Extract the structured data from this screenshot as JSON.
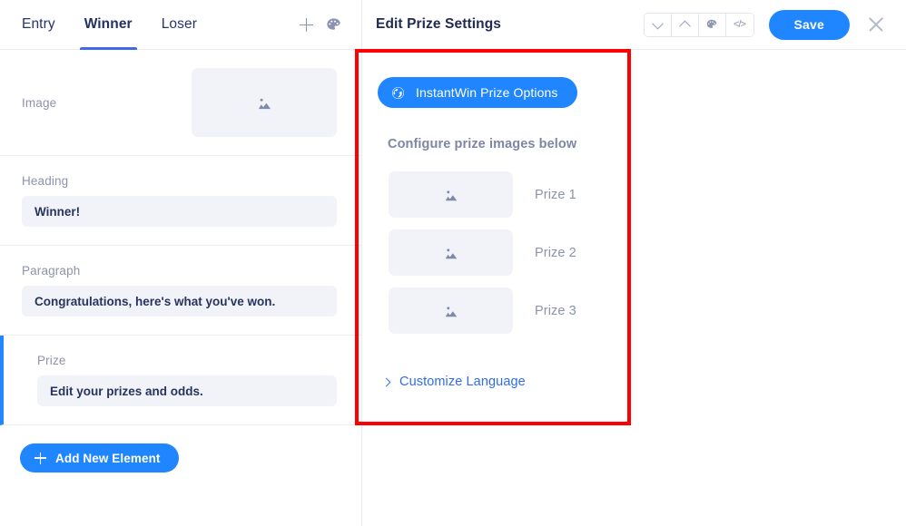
{
  "left_panel": {
    "tabs": [
      {
        "label": "Entry",
        "active": false
      },
      {
        "label": "Winner",
        "active": true
      },
      {
        "label": "Loser",
        "active": false
      }
    ],
    "toolbar": {
      "add_icon": "plus-icon",
      "theme_icon": "palette-icon"
    },
    "fields": [
      {
        "label": "Image",
        "type": "image",
        "placeholder_icon": "image-placeholder-icon",
        "selected": false
      },
      {
        "label": "Heading",
        "type": "text",
        "value": "Winner!",
        "selected": false
      },
      {
        "label": "Paragraph",
        "type": "text",
        "value": "Congratulations, here's what you've won.",
        "selected": false
      },
      {
        "label": "Prize",
        "type": "text",
        "value": "Edit your prizes and odds.",
        "selected": true
      }
    ],
    "add_element_button": "Add New Element"
  },
  "right_panel": {
    "title": "Edit Prize Settings",
    "toolbar_buttons": [
      {
        "name": "move-down-button",
        "icon": "chevron-down-icon"
      },
      {
        "name": "move-up-button",
        "icon": "chevron-up-icon"
      },
      {
        "name": "theme-button",
        "icon": "palette-icon"
      },
      {
        "name": "code-button",
        "icon": "code-icon",
        "glyph": "</>"
      }
    ],
    "save_label": "Save",
    "close_icon": "close-icon",
    "instantwin_button": {
      "label": "InstantWin Prize Options",
      "icon": "globe-icon"
    },
    "section_label": "Configure prize images below",
    "prizes": [
      {
        "name": "Prize 1",
        "thumb_icon": "image-placeholder-icon"
      },
      {
        "name": "Prize 2",
        "thumb_icon": "image-placeholder-icon"
      },
      {
        "name": "Prize 3",
        "thumb_icon": "image-placeholder-icon"
      }
    ],
    "customize_language": {
      "label": "Customize Language",
      "icon": "chevron-right-icon"
    }
  },
  "annotation": {
    "color": "#ff0000",
    "shape": "rectangle"
  },
  "colors": {
    "primary_blue": "#1f86ff",
    "accent_blue": "#2186ff",
    "tab_underline": "#4169e1",
    "field_bg": "#f1f3f8",
    "label_gray": "#8d93ab",
    "title_navy": "#1f2a52",
    "link_blue": "#2f6bf6",
    "annotation_red": "#ff0000"
  }
}
